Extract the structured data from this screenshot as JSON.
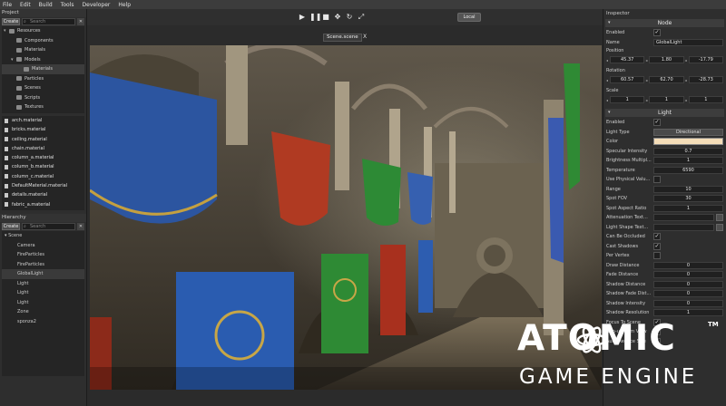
{
  "menu": [
    "File",
    "Edit",
    "Build",
    "Tools",
    "Developer",
    "Help"
  ],
  "toolbar": {
    "play_icon": "play-icon",
    "pause_icon": "pause-icon",
    "local_label": "Local"
  },
  "project": {
    "header": "Project",
    "create_label": "Create",
    "search_placeholder": "Search",
    "folders": [
      {
        "label": "Resources",
        "indent": 0,
        "arrow": "▾"
      },
      {
        "label": "Components",
        "indent": 1,
        "arrow": ""
      },
      {
        "label": "Materials",
        "indent": 1,
        "arrow": ""
      },
      {
        "label": "Models",
        "indent": 1,
        "arrow": "▾"
      },
      {
        "label": "Materials",
        "indent": 2,
        "arrow": ""
      },
      {
        "label": "Particles",
        "indent": 1,
        "arrow": ""
      },
      {
        "label": "Scenes",
        "indent": 1,
        "arrow": ""
      },
      {
        "label": "Scripts",
        "indent": 1,
        "arrow": ""
      },
      {
        "label": "Textures",
        "indent": 1,
        "arrow": ""
      }
    ],
    "files": [
      "arch.material",
      "bricks.material",
      "ceiling.material",
      "chain.material",
      "column_a.material",
      "column_b.material",
      "column_c.material",
      "DefaultMaterial.material",
      "details.material",
      "fabric_a.material"
    ]
  },
  "hierarchy": {
    "header": "Hierarchy",
    "create_label": "Create",
    "search_placeholder": "Search",
    "items": [
      {
        "label": "Scene",
        "indent": 0,
        "arrow": "▾"
      },
      {
        "label": "Camera",
        "indent": 1,
        "arrow": ""
      },
      {
        "label": "FireParticles",
        "indent": 1,
        "arrow": ""
      },
      {
        "label": "FireParticles",
        "indent": 1,
        "arrow": ""
      },
      {
        "label": "GlobalLight",
        "indent": 1,
        "arrow": ""
      },
      {
        "label": "Light",
        "indent": 1,
        "arrow": ""
      },
      {
        "label": "Light",
        "indent": 1,
        "arrow": ""
      },
      {
        "label": "Light",
        "indent": 1,
        "arrow": ""
      },
      {
        "label": "Zone",
        "indent": 1,
        "arrow": ""
      },
      {
        "label": "sponza2",
        "indent": 1,
        "arrow": ""
      }
    ]
  },
  "scene_tab": {
    "label": "Scene.scene",
    "close": "X"
  },
  "inspector": {
    "header": "Inspector",
    "node_section": "Node",
    "enabled_label": "Enabled",
    "name_label": "Name",
    "name_value": "GlobalLight",
    "position_label": "Position",
    "position": [
      "45.37",
      "1.80",
      "-17.79"
    ],
    "rotation_label": "Rotation",
    "rotation": [
      "60.57",
      "62.70",
      "-28.73"
    ],
    "scale_label": "Scale",
    "scale": [
      "1",
      "1",
      "1"
    ],
    "light_section": "Light",
    "light_rows": [
      {
        "label": "Enabled",
        "kind": "check",
        "value": "✓"
      },
      {
        "label": "Light Type",
        "kind": "dropdown",
        "value": "Directional"
      },
      {
        "label": "Color",
        "kind": "color",
        "value": ""
      },
      {
        "label": "Specular Intensity",
        "kind": "field",
        "value": "0.7"
      },
      {
        "label": "Brightness Multipl...",
        "kind": "field",
        "value": "1"
      },
      {
        "label": "Temperature",
        "kind": "field",
        "value": "6590"
      },
      {
        "label": "Use Physical Valu...",
        "kind": "check",
        "value": ""
      },
      {
        "label": "Range",
        "kind": "field",
        "value": "10"
      },
      {
        "label": "Spot FOV",
        "kind": "field",
        "value": "30"
      },
      {
        "label": "Spot Aspect Ratio",
        "kind": "field",
        "value": "1"
      },
      {
        "label": "Attenuation Text...",
        "kind": "fieldbtn",
        "value": ""
      },
      {
        "label": "Light Shape Text...",
        "kind": "fieldbtn",
        "value": ""
      },
      {
        "label": "Can Be Occluded",
        "kind": "check",
        "value": "✓"
      },
      {
        "label": "Cast Shadows",
        "kind": "check",
        "value": "✓"
      },
      {
        "label": "Per Vertex",
        "kind": "check",
        "value": ""
      },
      {
        "label": "Draw Distance",
        "kind": "field",
        "value": "0"
      },
      {
        "label": "Fade Distance",
        "kind": "field",
        "value": "0"
      },
      {
        "label": "Shadow Distance",
        "kind": "field",
        "value": "0"
      },
      {
        "label": "Shadow Fade Dist...",
        "kind": "field",
        "value": "0"
      },
      {
        "label": "Shadow Intensity",
        "kind": "field",
        "value": "0"
      },
      {
        "label": "Shadow Resolution",
        "kind": "field",
        "value": "1"
      },
      {
        "label": "Focus To Scene",
        "kind": "check",
        "value": "✓"
      },
      {
        "label": "Non-uniform View",
        "kind": "check",
        "value": "✓"
      },
      {
        "label": "Auto-Reduce Size",
        "kind": "check",
        "value": "✓"
      }
    ]
  },
  "logo": {
    "title": "ATOMIC",
    "tm": "TM",
    "subtitle": "GAME ENGINE"
  }
}
